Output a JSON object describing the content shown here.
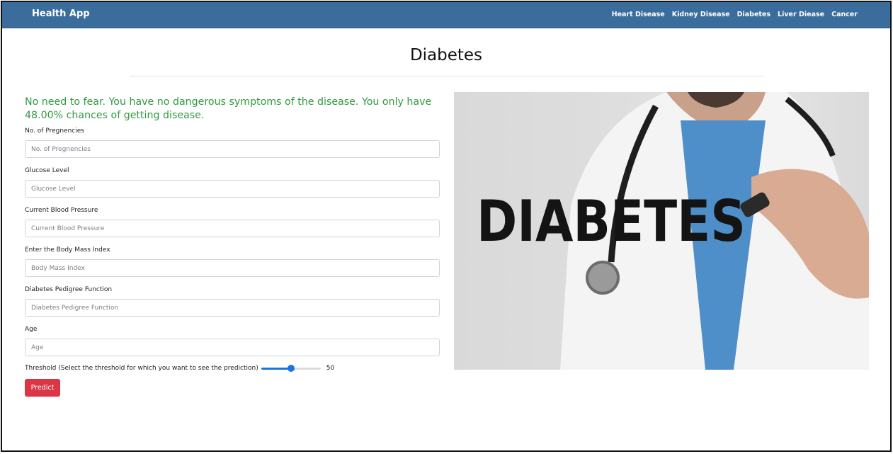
{
  "navbar": {
    "brand": "Health App",
    "links": [
      "Heart Disease",
      "Kidney Disease",
      "Diabetes",
      "Liver Diease",
      "Cancer"
    ]
  },
  "page": {
    "title": "Diabetes"
  },
  "result": {
    "message": "No need to fear. You have no dangerous symptoms of the disease. You only have 48.00% chances of getting disease."
  },
  "form": {
    "fields": [
      {
        "label": "No. of Pregnencies",
        "placeholder": "No. of Pregnencies",
        "value": ""
      },
      {
        "label": "Glucose Level",
        "placeholder": "Glucose Level",
        "value": ""
      },
      {
        "label": "Current Blood Pressure",
        "placeholder": "Current Blood Pressure",
        "value": ""
      },
      {
        "label": "Enter the Body Mass Index",
        "placeholder": "Body Mass Index",
        "value": ""
      },
      {
        "label": "Diabetes Pedigree Function",
        "placeholder": "Diabetes Pedigree Function",
        "value": ""
      },
      {
        "label": "Age",
        "placeholder": "Age",
        "value": ""
      }
    ],
    "threshold": {
      "label": "Threshold (Select the threshold for which you want to see the prediction)",
      "value": 50,
      "value_text": "50",
      "min": 0,
      "max": 100
    },
    "submit_label": "Predict"
  },
  "hero_image": {
    "text": "DIABETES"
  },
  "colors": {
    "navbar": "#3a6d9c",
    "result_text": "#2f9b41",
    "predict_button": "#dc3545",
    "slider_accent": "#1a73e8"
  }
}
